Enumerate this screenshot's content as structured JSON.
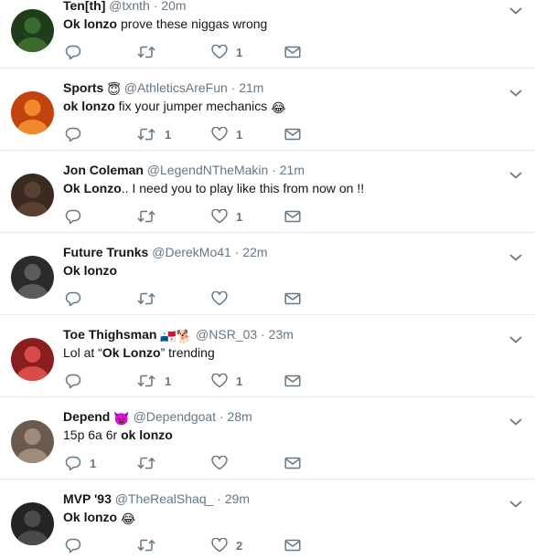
{
  "tweets": [
    {
      "name": "Ten[th]",
      "handle": "@txnth",
      "time": "20m",
      "text_bold": "Ok lonzo",
      "text_rest": " prove these niggas wrong",
      "text_pre": "",
      "text_after": "",
      "replies": "",
      "retweets": "",
      "likes": "1",
      "avatar_color": "#1f3d1a"
    },
    {
      "name": "Sports",
      "name_emoji": "😇",
      "handle": "@AthleticsAreFun",
      "time": "21m",
      "text_pre": "",
      "text_bold": "ok lonzo",
      "text_rest": " fix your jumper mechanics ",
      "text_emoji": "😂",
      "text_after": "",
      "replies": "",
      "retweets": "1",
      "likes": "1",
      "avatar_color": "#c1440e"
    },
    {
      "name": "Jon Coleman",
      "handle": "@LegendNTheMakin",
      "time": "21m",
      "text_pre": "",
      "text_bold": "Ok Lonzo",
      "text_rest": ".. I need you to play like this from now on !!",
      "text_after": "",
      "replies": "",
      "retweets": "",
      "likes": "1",
      "avatar_color": "#3a2a22"
    },
    {
      "name": "Future Trunks",
      "handle": "@DerekMo41",
      "time": "22m",
      "text_pre": "",
      "text_bold": "Ok lonzo",
      "text_rest": "",
      "text_after": "",
      "replies": "",
      "retweets": "",
      "likes": "",
      "avatar_color": "#2b2b2b"
    },
    {
      "name": "Toe Thighsman",
      "name_emoji": "🇵🇦🐕",
      "handle": "@NSR_03",
      "time": "23m",
      "text_pre": "Lol at “",
      "text_bold": "Ok Lonzo",
      "text_rest": "” trending",
      "text_after": "",
      "replies": "",
      "retweets": "1",
      "likes": "1",
      "avatar_color": "#8a1d1d"
    },
    {
      "name": "Depend",
      "name_emoji": "👿",
      "handle": "@Dependgoat",
      "time": "28m",
      "text_pre": "15p 6a 6r ",
      "text_bold": "ok lonzo",
      "text_rest": "",
      "text_after": "",
      "replies": "1",
      "retweets": "",
      "likes": "",
      "avatar_color": "#6b5a4e"
    },
    {
      "name": "MVP '93",
      "handle": "@TheRealShaq_",
      "time": "29m",
      "text_pre": "",
      "text_bold": "Ok lonzo",
      "text_rest": " ",
      "text_emoji": "😂",
      "text_after": "",
      "replies": "",
      "retweets": "",
      "likes": "2",
      "avatar_color": "#242424"
    }
  ],
  "colors": {
    "text": "#14171a",
    "muted": "#657786",
    "icon": "#657786",
    "divider": "#e6ecf0"
  },
  "icons": {
    "reply": "reply-icon",
    "retweet": "retweet-icon",
    "like": "heart-icon",
    "dm": "envelope-icon",
    "more": "chevron-down-icon"
  }
}
